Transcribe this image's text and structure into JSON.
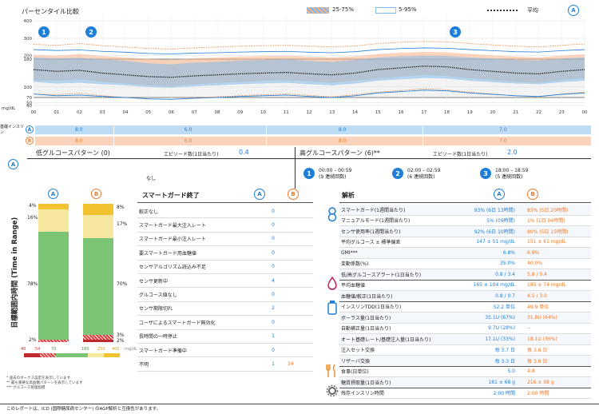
{
  "header": {
    "title": "パーセンタイル比較",
    "legend_25_75": "25-75%",
    "legend_5_95": "5-95%",
    "legend_avg": "平均",
    "badge_a": "A"
  },
  "markers": [
    {
      "label": "1"
    },
    {
      "label": "2"
    },
    {
      "label": "3"
    }
  ],
  "chart_data": {
    "type": "area",
    "xlabel": "",
    "ylabel": "mg/dL",
    "y_ticks": [
      "400",
      "300",
      "200",
      "180",
      "100",
      "70",
      "50",
      "40"
    ],
    "ylim": [
      40,
      400
    ],
    "x_ticks": [
      "00",
      "01",
      "02",
      "03",
      "04",
      "05",
      "06",
      "07",
      "08",
      "09",
      "10",
      "11",
      "12",
      "13",
      "14",
      "15",
      "16",
      "17",
      "18",
      "19",
      "20",
      "21",
      "22",
      "23",
      "00"
    ],
    "target_range": [
      70,
      180
    ],
    "series": [
      {
        "name": "平均",
        "values": [
          150,
          145,
          148,
          140,
          135,
          130,
          128,
          132,
          135,
          138,
          140,
          142,
          138,
          135,
          140,
          150,
          155,
          160,
          158,
          150,
          145,
          140,
          138,
          145,
          150
        ]
      },
      {
        "name": "A 25-75%",
        "low": [
          115,
          110,
          112,
          108,
          105,
          100,
          98,
          102,
          105,
          108,
          110,
          112,
          108,
          105,
          110,
          118,
          122,
          126,
          124,
          118,
          114,
          110,
          108,
          114,
          118
        ],
        "high": [
          190,
          185,
          188,
          180,
          175,
          168,
          165,
          170,
          172,
          176,
          178,
          180,
          175,
          172,
          178,
          190,
          196,
          200,
          198,
          190,
          184,
          178,
          176,
          184,
          190
        ]
      },
      {
        "name": "B 25-75%",
        "low": [
          120,
          118,
          122,
          115,
          110,
          105,
          103,
          108,
          112,
          115,
          118,
          120,
          116,
          112,
          118,
          125,
          130,
          135,
          132,
          125,
          120,
          115,
          112,
          120,
          125
        ],
        "high": [
          205,
          200,
          210,
          198,
          190,
          182,
          178,
          185,
          190,
          195,
          198,
          200,
          195,
          190,
          196,
          210,
          218,
          222,
          220,
          210,
          202,
          195,
          190,
          200,
          208
        ]
      }
    ]
  },
  "basal_rates": {
    "row_a_label": "A",
    "row_b_label": "B",
    "side_label": "基礎インスリン",
    "a_values": [
      "8.0",
      "6.0",
      "8.0",
      "7.0"
    ],
    "b_values": [
      "8.0",
      "6.0",
      "8.0",
      "7.0"
    ]
  },
  "patterns": {
    "low_title": "低グルコースパターン (0)",
    "low_episodes_label": "エピソード数(1日当たり)",
    "low_episodes_value": "0.4",
    "low_none": "なし",
    "high_title": "高グルコースパターン (6)**",
    "high_episodes_label": "エピソード数(1日当たり)",
    "high_episodes_value": "2.0",
    "high_items": [
      {
        "num": "1",
        "time": "00:00 – 00:59",
        "count": "(9 連続回数)"
      },
      {
        "num": "2",
        "time": "02:00 – 02:59",
        "count": "(6 連続回数)"
      },
      {
        "num": "3",
        "time": "18:00 – 18:59",
        "count": "(5 連続回数)"
      }
    ]
  },
  "tir": {
    "axis_label": "目標範囲内時間 (Time in Range)",
    "a_label": "A",
    "b_label": "B",
    "a_values": [
      "4%",
      "16%",
      "78%",
      "2%"
    ],
    "b_values": [
      "8%",
      "17%",
      "70%",
      "3%",
      "2%"
    ],
    "legend_ticks": [
      "40",
      "54",
      "70",
      "180",
      "250",
      "400",
      "mg/dL"
    ],
    "footnote1": "* 過去のボーナス設定を表示しています",
    "footnote2": "** 最も重要な高血糖パターンを表示しています",
    "footnote3": "*** グルコース管理指標"
  },
  "smartguard": {
    "title": "スマートガード終了",
    "col_a": "A",
    "col_b": "B",
    "rows": [
      {
        "label": "較正なし",
        "a": "0",
        "b": ""
      },
      {
        "label": "スマートガード最大注入レート",
        "a": "0",
        "b": ""
      },
      {
        "label": "スマートガード最小注入レート",
        "a": "0",
        "b": ""
      },
      {
        "label": "要スマートガード用血糖値",
        "a": "0",
        "b": ""
      },
      {
        "label": "センサアルゴリズム読込み不足",
        "a": "0",
        "b": ""
      },
      {
        "label": "センサ更新中",
        "a": "4",
        "b": ""
      },
      {
        "label": "グルコース値なし",
        "a": "0",
        "b": ""
      },
      {
        "label": "センサ期限切れ",
        "a": "2",
        "b": ""
      },
      {
        "label": "ユーザによるスマートガード無効化",
        "a": "0",
        "b": ""
      },
      {
        "label": "長時間の一時停止",
        "a": "1",
        "b": ""
      },
      {
        "label": "スマートガード準備中",
        "a": "0",
        "b": ""
      },
      {
        "label": "不明",
        "a": "1",
        "b": "34"
      }
    ]
  },
  "analysis": {
    "title": "解析",
    "col_a": "A",
    "col_b": "B",
    "rows": [
      {
        "label": "スマートガード(1週間当たり)",
        "a": "93% (6日 13時間)",
        "b": "83% (5日 20時間)"
      },
      {
        "label": "マニュアルモード(1週間当たり)",
        "a": "5% (09時間)",
        "b": "1% (1日 04時間)"
      },
      {
        "label": "センサ使用率(1週間当たり)",
        "a": "92% (6日 10時間)",
        "b": "80% (5日 15時間)"
      },
      {
        "label": "平均グルコース ± 標準偏差",
        "a": "147 ± 51 mg/dL",
        "b": "151 ± 61 mg/dL"
      },
      {
        "label": "GMI***",
        "a": "6.8%",
        "b": "6.9%"
      },
      {
        "label": "変動係数(%)",
        "a": "35.0%",
        "b": "40.0%"
      },
      {
        "label": "低/高グルコースアラート(1日当たり)",
        "a": "0.8 / 3.4",
        "b": "5.8 / 0.4"
      },
      {
        "label": "平均血糖値",
        "a": "165 ± 104 mg/dL",
        "b": "185 ± 74 mg/dL"
      },
      {
        "label": "血糖値/較正(1日当たり)",
        "a": "0.8 / 0.7",
        "b": "4.5 / 3.0"
      },
      {
        "label": "インスリンTDD(1日当たり)",
        "a": "52.2 単位",
        "b": "49.9 単位"
      },
      {
        "label": "ボーラス量(1日当たり)",
        "a": "35.1U (67%)",
        "b": "31.8U (64%)"
      },
      {
        "label": "自動補正量(1日当たり)",
        "a": "9.7U (28%)",
        "b": "--"
      },
      {
        "label": "オート基礎レート/基礎注入量(1日当たり)",
        "a": "17.1U (33%)",
        "b": "18.1U (36%)"
      },
      {
        "label": "注入セット交換",
        "a": "毎 3.7 日",
        "b": "毎 3.6 日"
      },
      {
        "label": "リザーバ交換",
        "a": "毎 3.3 日",
        "b": "毎 3.6 日"
      },
      {
        "label": "食事(日単位)",
        "a": "5.0",
        "b": "4.8"
      },
      {
        "label": "糖質摂取量(1日当たり)",
        "a": "181 ± 68 g",
        "b": "216 ± 98 g"
      },
      {
        "label": "残存インスリン時間",
        "a": "2:00 時間",
        "b": "2:00 時間"
      }
    ]
  },
  "footer": "このレポートは、ICD (国際糖尿病センター) のAGP解析と互換性があります。",
  "colors": {
    "a": "#1f7fd8",
    "b": "#f07a2a",
    "in_range": "#7cc576",
    "high": "#f5e79e",
    "very_high": "#f2c230",
    "low": "#e03a3a"
  }
}
